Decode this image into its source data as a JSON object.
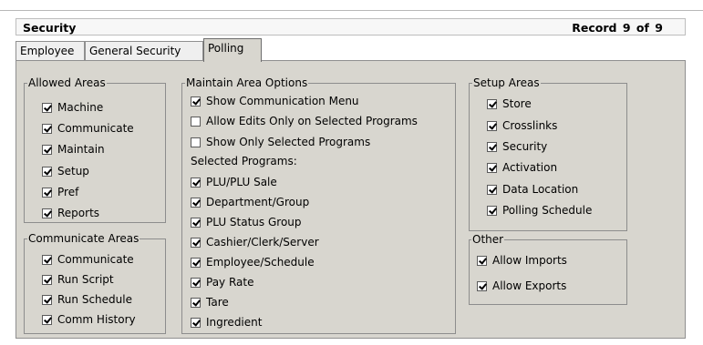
{
  "header": {
    "title": "Security",
    "record": "Record  9  of  9"
  },
  "tabs": [
    {
      "label": "Employee",
      "active": false
    },
    {
      "label": "General Security",
      "active": false
    },
    {
      "label": "Polling",
      "active": true
    }
  ],
  "allowed_areas": {
    "legend": "Allowed Areas",
    "items": [
      {
        "label": "Machine",
        "checked": true
      },
      {
        "label": "Communicate",
        "checked": true
      },
      {
        "label": "Maintain",
        "checked": true
      },
      {
        "label": "Setup",
        "checked": true
      },
      {
        "label": "Pref",
        "checked": true
      },
      {
        "label": "Reports",
        "checked": true
      }
    ]
  },
  "communicate_areas": {
    "legend": "Communicate Areas",
    "items": [
      {
        "label": "Communicate",
        "checked": true
      },
      {
        "label": "Run Script",
        "checked": true
      },
      {
        "label": "Run Schedule",
        "checked": true
      },
      {
        "label": "Comm History",
        "checked": true
      }
    ]
  },
  "maintain_options": {
    "legend": "Maintain Area Options",
    "options": [
      {
        "label": "Show Communication Menu",
        "checked": true
      },
      {
        "label": "Allow Edits Only on Selected Programs",
        "checked": false
      },
      {
        "label": "Show Only Selected Programs",
        "checked": false
      }
    ],
    "selected_label": "Selected Programs:",
    "programs": [
      {
        "label": "PLU/PLU Sale",
        "checked": true
      },
      {
        "label": "Department/Group",
        "checked": true
      },
      {
        "label": "PLU Status Group",
        "checked": true
      },
      {
        "label": "Cashier/Clerk/Server",
        "checked": true
      },
      {
        "label": "Employee/Schedule",
        "checked": true
      },
      {
        "label": "Pay Rate",
        "checked": true
      },
      {
        "label": "Tare",
        "checked": true
      },
      {
        "label": "Ingredient",
        "checked": true
      }
    ]
  },
  "setup_areas": {
    "legend": "Setup Areas",
    "items": [
      {
        "label": "Store",
        "checked": true
      },
      {
        "label": "Crosslinks",
        "checked": true
      },
      {
        "label": "Security",
        "checked": true
      },
      {
        "label": "Activation",
        "checked": true
      },
      {
        "label": "Data Location",
        "checked": true
      },
      {
        "label": "Polling Schedule",
        "checked": true
      }
    ]
  },
  "other": {
    "legend": "Other",
    "items": [
      {
        "label": "Allow Imports",
        "checked": true
      },
      {
        "label": "Allow Exports",
        "checked": true
      }
    ]
  }
}
